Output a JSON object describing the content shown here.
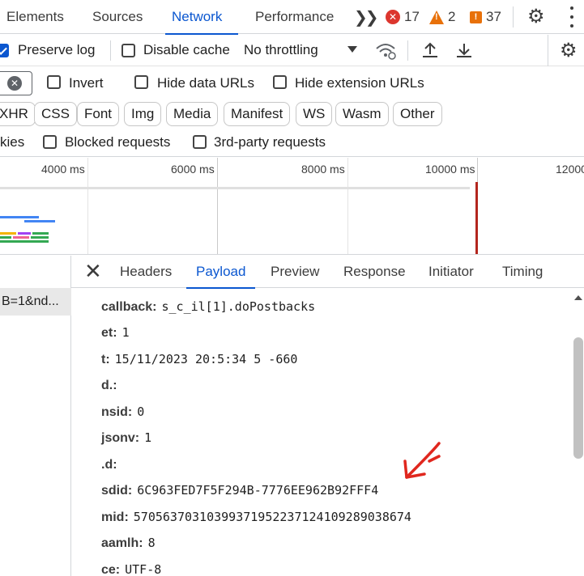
{
  "tabs": [
    "Elements",
    "Sources",
    "Network",
    "Performance"
  ],
  "active_tab": "Network",
  "badges": {
    "errors": "17",
    "warnings": "2",
    "issues": "37"
  },
  "toolbar": {
    "preserve_log": "Preserve log",
    "disable_cache": "Disable cache",
    "throttling": "No throttling"
  },
  "filters": {
    "invert": "Invert",
    "hide_data_urls": "Hide data URLs",
    "hide_extension_urls": "Hide extension URLs"
  },
  "type_chips": [
    "XHR",
    "CSS",
    "Font",
    "Img",
    "Media",
    "Manifest",
    "WS",
    "Wasm",
    "Other"
  ],
  "row4": {
    "cookies_partial": "kies",
    "blocked_requests": "Blocked requests",
    "third_party": "3rd-party requests"
  },
  "timeline_ticks": [
    "4000 ms",
    "6000 ms",
    "8000 ms",
    "10000 ms",
    "12000"
  ],
  "request_item": "B=1&nd...",
  "detail_tabs": [
    "Headers",
    "Payload",
    "Preview",
    "Response",
    "Initiator",
    "Timing"
  ],
  "active_detail_tab": "Payload",
  "payload": [
    {
      "key": "callback:",
      "value": "s_c_il[1].doPostbacks"
    },
    {
      "key": "et:",
      "value": "1"
    },
    {
      "key": "t:",
      "value": "15/11/2023 20:5:34 5 -660"
    },
    {
      "key": "d.:",
      "value": ""
    },
    {
      "key": "nsid:",
      "value": "0"
    },
    {
      "key": "jsonv:",
      "value": "1"
    },
    {
      "key": ".d:",
      "value": ""
    },
    {
      "key": "sdid:",
      "value": "6C963FED7F5F294B-7776EE962B92FFF4"
    },
    {
      "key": "mid:",
      "value": "57056370310399371952237124109289038674"
    },
    {
      "key": "aamlh:",
      "value": "8"
    },
    {
      "key": "ce:",
      "value": "UTF-8"
    }
  ],
  "colors": {
    "accent": "#0b57d0",
    "error": "#dc362e",
    "warning": "#e8710a",
    "annotation": "#e0271e"
  }
}
